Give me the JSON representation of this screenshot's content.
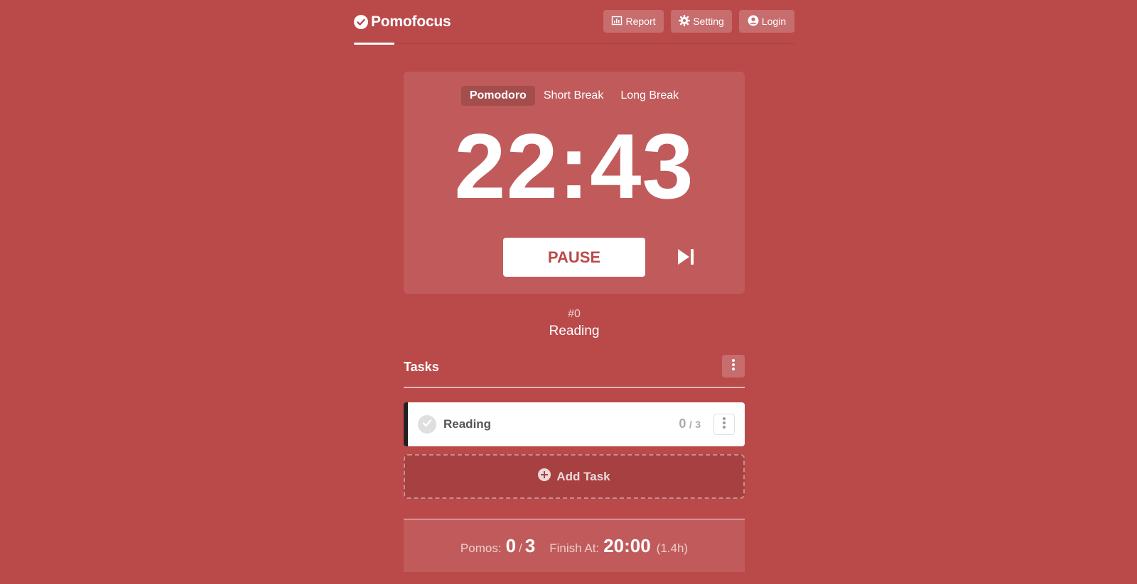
{
  "header": {
    "app_name": "Pomofocus",
    "buttons": {
      "report": "Report",
      "setting": "Setting",
      "login": "Login"
    }
  },
  "timer": {
    "modes": [
      "Pomodoro",
      "Short Break",
      "Long Break"
    ],
    "active_mode": "Pomodoro",
    "time": "22:43",
    "pause_label": "PAUSE"
  },
  "current": {
    "count": "#0",
    "task_name": "Reading"
  },
  "tasks": {
    "title": "Tasks",
    "items": [
      {
        "name": "Reading",
        "done": "0",
        "separator": "/",
        "estimate": "3"
      }
    ],
    "add_label": "Add Task"
  },
  "summary": {
    "pomos_label": "Pomos:",
    "pomos_done": "0",
    "pomos_sep": "/",
    "pomos_total": "3",
    "finish_label": "Finish At:",
    "finish_time": "20:00",
    "finish_hours": "(1.4h)"
  },
  "colors": {
    "background": "#ba4949",
    "accent_text": "#ba4949",
    "card": "#ffffff"
  }
}
